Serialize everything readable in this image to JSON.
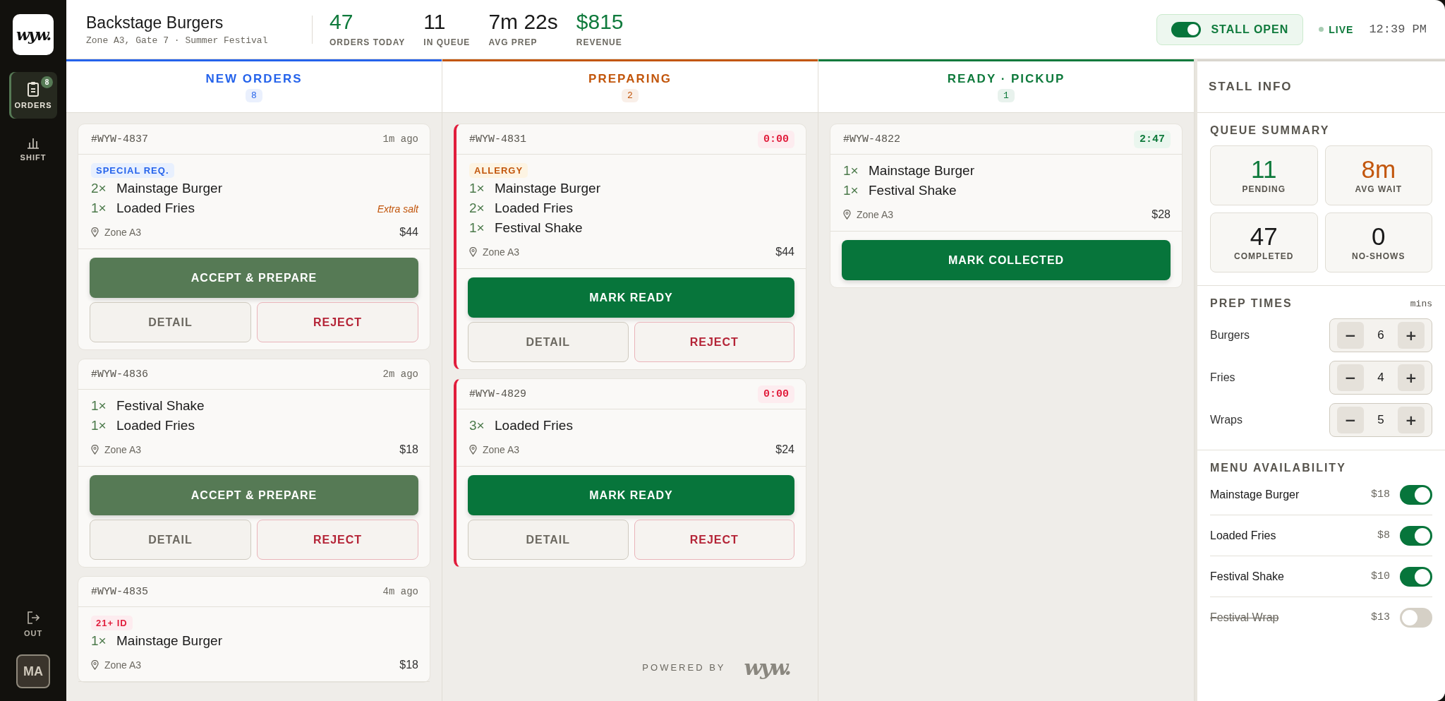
{
  "sidebar": {
    "logo": "wyw.",
    "nav": [
      {
        "kind": "orders",
        "label": "ORDERS",
        "badge": "8",
        "selected": true
      },
      {
        "kind": "shift",
        "label": "SHIFT",
        "selected": false
      }
    ],
    "logout": "OUT",
    "avatar": "MA"
  },
  "header": {
    "stall": "Backstage Burgers",
    "location": "Zone A3, Gate 7 · Summer Festival",
    "stats": [
      {
        "value": "47",
        "label": "ORDERS TODAY",
        "color": "#0f7a3c"
      },
      {
        "value": "11",
        "label": "IN QUEUE",
        "color": "#1a1a1a"
      },
      {
        "value": "7m 22s",
        "label": "AVG PREP",
        "color": "#1a1a1a"
      },
      {
        "value": "$815",
        "label": "REVENUE",
        "color": "#0f7a3c"
      }
    ],
    "stall_toggle": {
      "label": "STALL OPEN",
      "on": true
    },
    "live": "LIVE",
    "time": "12:39 PM"
  },
  "columns": [
    {
      "title": "NEW ORDERS",
      "count": "8",
      "color": "#2563eb",
      "orders": [
        {
          "id": "#WYW-4837",
          "time": {
            "text": "1m ago",
            "kind": "age"
          },
          "overdue": false,
          "tag": {
            "label": "SPECIAL REQ.",
            "kind": "special"
          },
          "items": [
            {
              "qty": "2×",
              "name": "Mainstage Burger"
            },
            {
              "qty": "1×",
              "name": "Loaded Fries",
              "note": "Extra salt"
            }
          ],
          "zone": "Zone A3",
          "total": "$44",
          "actions": [
            {
              "label": "ACCEPT & PREPARE",
              "kind": "accept"
            },
            {
              "label": "DETAIL",
              "kind": "detail"
            },
            {
              "label": "REJECT",
              "kind": "reject"
            }
          ]
        },
        {
          "id": "#WYW-4836",
          "time": {
            "text": "2m ago",
            "kind": "age"
          },
          "overdue": false,
          "items": [
            {
              "qty": "1×",
              "name": "Festival Shake"
            },
            {
              "qty": "1×",
              "name": "Loaded Fries"
            }
          ],
          "zone": "Zone A3",
          "total": "$18",
          "actions": [
            {
              "label": "ACCEPT & PREPARE",
              "kind": "accept"
            },
            {
              "label": "DETAIL",
              "kind": "detail"
            },
            {
              "label": "REJECT",
              "kind": "reject"
            }
          ]
        },
        {
          "id": "#WYW-4835",
          "time": {
            "text": "4m ago",
            "kind": "age"
          },
          "overdue": false,
          "tag": {
            "label": "21+ ID",
            "kind": "id"
          },
          "items": [
            {
              "qty": "1×",
              "name": "Mainstage Burger"
            }
          ],
          "zone": "Zone A3",
          "total": "$18"
        }
      ]
    },
    {
      "title": "PREPARING",
      "count": "2",
      "color": "#c2560c",
      "orders": [
        {
          "id": "#WYW-4831",
          "time": {
            "text": "0:00",
            "kind": "overdue"
          },
          "overdue": true,
          "tag": {
            "label": "ALLERGY",
            "kind": "allergy"
          },
          "items": [
            {
              "qty": "1×",
              "name": "Mainstage Burger"
            },
            {
              "qty": "2×",
              "name": "Loaded Fries"
            },
            {
              "qty": "1×",
              "name": "Festival Shake"
            }
          ],
          "zone": "Zone A3",
          "total": "$44",
          "actions": [
            {
              "label": "MARK READY",
              "kind": "ready"
            },
            {
              "label": "DETAIL",
              "kind": "detail"
            },
            {
              "label": "REJECT",
              "kind": "reject"
            }
          ]
        },
        {
          "id": "#WYW-4829",
          "time": {
            "text": "0:00",
            "kind": "overdue"
          },
          "overdue": true,
          "items": [
            {
              "qty": "3×",
              "name": "Loaded Fries"
            }
          ],
          "zone": "Zone A3",
          "total": "$24",
          "actions": [
            {
              "label": "MARK READY",
              "kind": "ready"
            },
            {
              "label": "DETAIL",
              "kind": "detail"
            },
            {
              "label": "REJECT",
              "kind": "reject"
            }
          ]
        }
      ],
      "footer": {
        "label": "POWERED BY",
        "logo": "wyw."
      }
    },
    {
      "title": "READY · PICKUP",
      "count": "1",
      "color": "#0f7a3c",
      "orders": [
        {
          "id": "#WYW-4822",
          "time": {
            "text": "2:47",
            "kind": "ok"
          },
          "overdue": false,
          "items": [
            {
              "qty": "1×",
              "name": "Mainstage Burger"
            },
            {
              "qty": "1×",
              "name": "Festival Shake"
            }
          ],
          "zone": "Zone A3",
          "total": "$28",
          "actions": [
            {
              "label": "MARK COLLECTED",
              "kind": "collect"
            }
          ]
        }
      ]
    }
  ],
  "stall_info": {
    "title": "STALL INFO",
    "queue": {
      "title": "QUEUE SUMMARY",
      "tiles": [
        {
          "value": "11",
          "label": "PENDING",
          "color": "#0f7a3c"
        },
        {
          "value": "8m",
          "label": "AVG WAIT",
          "color": "#c2560c"
        },
        {
          "value": "47",
          "label": "COMPLETED",
          "color": "#1a1a1a"
        },
        {
          "value": "0",
          "label": "NO-SHOWS",
          "color": "#1a1a1a"
        }
      ]
    },
    "prep": {
      "title": "PREP TIMES",
      "unit": "mins",
      "rows": [
        {
          "label": "Burgers",
          "value": "6",
          "minus": "−",
          "plus": "+"
        },
        {
          "label": "Fries",
          "value": "4",
          "minus": "−",
          "plus": "+"
        },
        {
          "label": "Wraps",
          "value": "5",
          "minus": "−",
          "plus": "+"
        }
      ]
    },
    "menu": {
      "title": "MENU AVAILABILITY",
      "items": [
        {
          "name": "Mainstage Burger",
          "price": "$18",
          "available": true
        },
        {
          "name": "Loaded Fries",
          "price": "$8",
          "available": true
        },
        {
          "name": "Festival Shake",
          "price": "$10",
          "available": true
        },
        {
          "name": "Festival Wrap",
          "price": "$13",
          "available": false
        }
      ]
    }
  }
}
